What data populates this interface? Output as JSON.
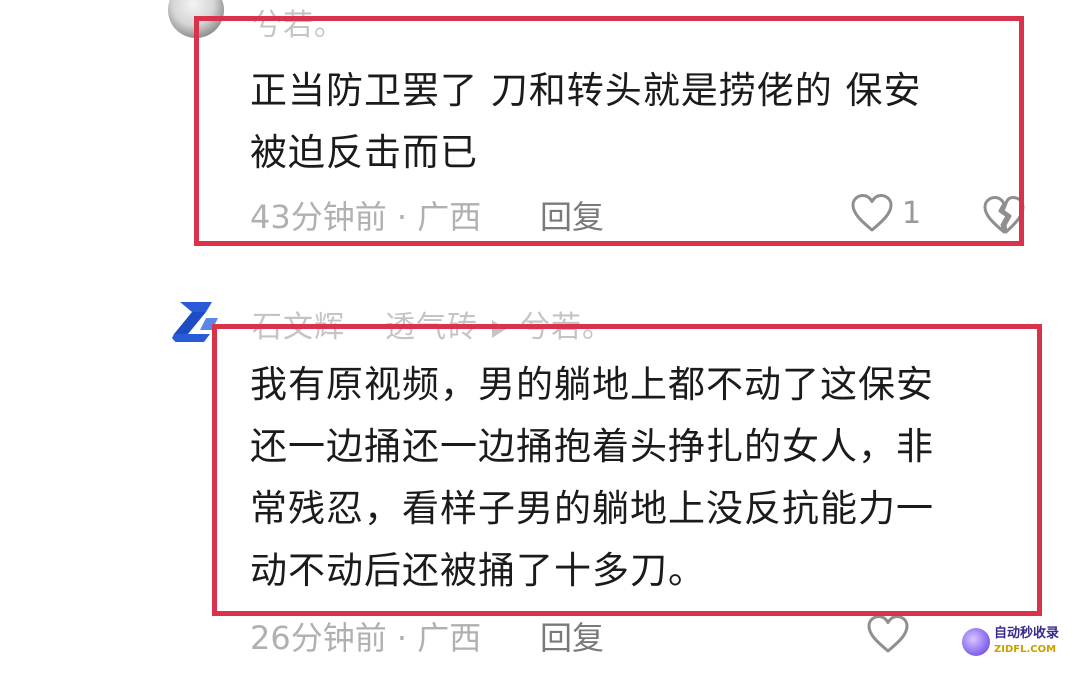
{
  "comments": [
    {
      "username": "兮若。",
      "text_lines": [
        "正当防卫罢了 刀和转头就是捞佬的 保安",
        "被迫反击而已"
      ],
      "meta": "43分钟前 · 广西",
      "reply_label": "回复",
      "like_count": "1"
    },
    {
      "username": "石文辉",
      "reply_to_prefix": "透气砖",
      "reply_to": "兮若。",
      "text_lines": [
        "我有原视频，男的躺地上都不动了这保安",
        "还一边捅还一边捅抱着头挣扎的女人，非",
        "常残忍，看样子男的躺地上没反抗能力一",
        "动不动后还被捅了十多刀。"
      ],
      "meta": "26分钟前 · 广西",
      "reply_label": "回复"
    }
  ],
  "icons": {
    "like": "heart-outline-icon",
    "dislike": "broken-heart-icon",
    "reply_arrow": "triangle-right-icon"
  },
  "colors": {
    "highlight_border": "#d8334a",
    "text": "#1b1b1b",
    "meta": "#b0b0b0",
    "avatar_blue": "#2a5bd7"
  },
  "watermark": {
    "title": "自动秒收录",
    "url": "ZIDFL.COM"
  }
}
